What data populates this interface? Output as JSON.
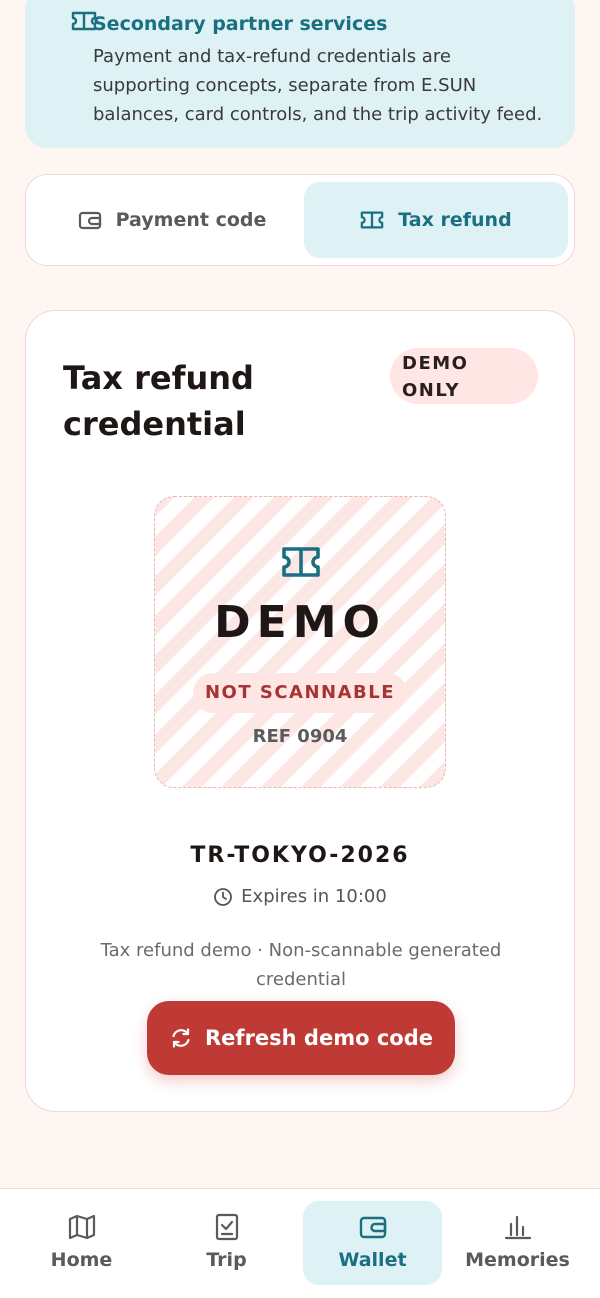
{
  "banner": {
    "title": "Secondary partner services",
    "body": "Payment and tax-refund credentials are supporting concepts, separate from E.SUN balances, card controls, and the trip activity feed.",
    "icon": "ticket-icon"
  },
  "tabs": {
    "payment": {
      "label": "Payment code",
      "icon": "wallet-icon"
    },
    "tax": {
      "label": "Tax refund",
      "icon": "ticket-icon",
      "active": true
    }
  },
  "card": {
    "title": "Tax refund credential",
    "badge": "DEMO ONLY",
    "qr": {
      "icon": "ticket-icon",
      "demo_text": "DEMO",
      "not_scannable": "NOT SCANNABLE",
      "ref": "REF 0904"
    },
    "code": "TR-TOKYO-2026",
    "expires": "Expires in 10:00",
    "caption": "Tax refund demo · Non-scannable generated credential",
    "refresh_label": "Refresh demo code"
  },
  "nav": {
    "home": "Home",
    "trip": "Trip",
    "wallet": "Wallet",
    "memories": "Memories",
    "active": "wallet"
  },
  "colors": {
    "accent_teal": "#1a6f80",
    "teal_bg": "#def1f4",
    "primary_red": "#bf3a34",
    "pink_bg": "#fde6e4"
  }
}
